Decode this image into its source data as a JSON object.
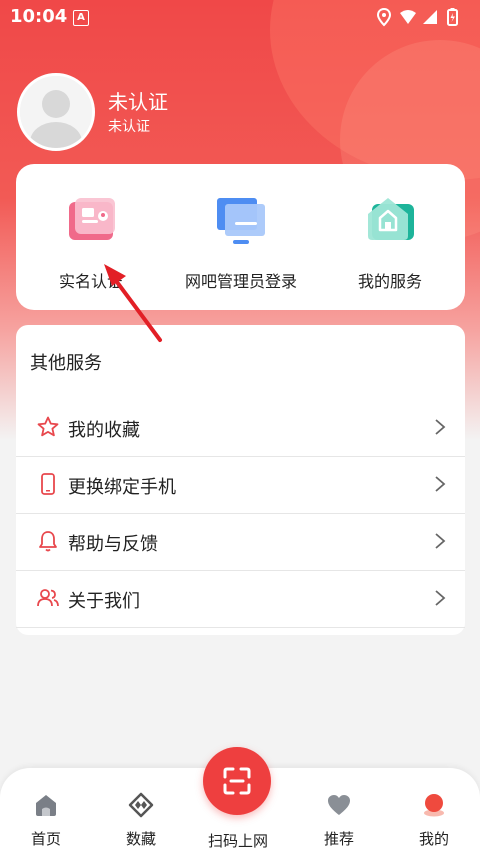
{
  "status_bar": {
    "time": "10:04",
    "badge": "A"
  },
  "profile": {
    "name": "未认证",
    "subtitle": "未认证"
  },
  "quick_actions": [
    {
      "label": "实名认证",
      "icon": "id-card-icon"
    },
    {
      "label": "网吧管理员登录",
      "icon": "monitor-icon"
    },
    {
      "label": "我的服务",
      "icon": "home-service-icon"
    }
  ],
  "other_services": {
    "title": "其他服务",
    "items": [
      {
        "label": "我的收藏",
        "icon": "star-icon"
      },
      {
        "label": "更换绑定手机",
        "icon": "phone-icon"
      },
      {
        "label": "帮助与反馈",
        "icon": "bell-icon"
      },
      {
        "label": "关于我们",
        "icon": "users-icon"
      }
    ]
  },
  "tabbar": {
    "items": [
      {
        "label": "首页",
        "icon": "home-icon"
      },
      {
        "label": "数藏",
        "icon": "collection-icon"
      },
      {
        "label": "扫码上网",
        "icon": "scan-icon"
      },
      {
        "label": "推荐",
        "icon": "heart-icon"
      },
      {
        "label": "我的",
        "icon": "profile-icon"
      }
    ]
  },
  "colors": {
    "primary": "#ee3f3f",
    "header_top": "#f04848",
    "icon_red": "#e8484d"
  }
}
